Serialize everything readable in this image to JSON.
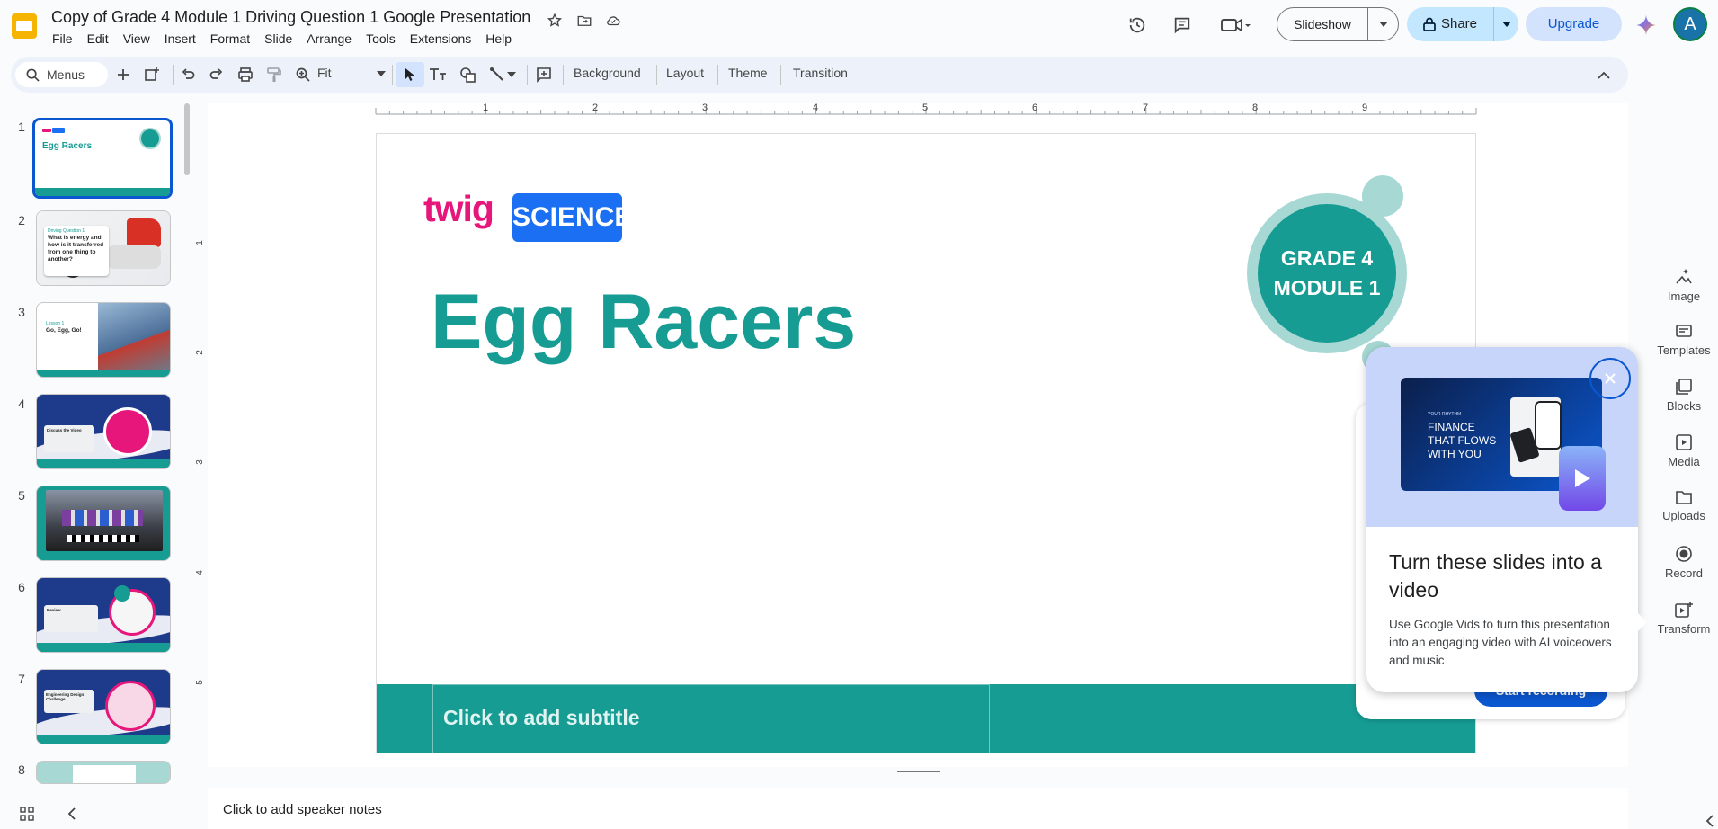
{
  "header": {
    "title": "Copy of Grade 4 Module 1 Driving Question 1 Google Presentation",
    "menu": [
      "File",
      "Edit",
      "View",
      "Insert",
      "Format",
      "Slide",
      "Arrange",
      "Tools",
      "Extensions",
      "Help"
    ],
    "slideshow_label": "Slideshow",
    "share_label": "Share",
    "upgrade_label": "Upgrade",
    "avatar_letter": "A"
  },
  "toolbar": {
    "search_label": "Menus",
    "zoom": "Fit",
    "background_label": "Background",
    "layout_label": "Layout",
    "theme_label": "Theme",
    "transition_label": "Transition"
  },
  "ruler": {
    "h": [
      "1",
      "2",
      "3",
      "4",
      "5",
      "6",
      "7",
      "8",
      "9"
    ],
    "v": [
      "1",
      "2",
      "3",
      "4",
      "5"
    ]
  },
  "filmstrip": {
    "numbers": [
      "1",
      "2",
      "3",
      "4",
      "5",
      "6",
      "7",
      "8"
    ],
    "thumbs": [
      {
        "title": "Egg Racers"
      },
      {
        "heading": "Driving Question 1",
        "body": "What is energy and how is it transferred from one thing to another?"
      },
      {
        "heading": "Lesson 1",
        "body": "Go, Egg, Go!"
      },
      {
        "body": "Discuss the Video"
      },
      {
        "body": ""
      },
      {
        "body": "Review"
      },
      {
        "body": "Engineering Design Challenge"
      },
      {
        "body": ""
      }
    ]
  },
  "slide": {
    "brand_twig": "twig",
    "brand_science": "SCIENCE",
    "badge_line1": "GRADE 4",
    "badge_line2": "MODULE 1",
    "title": "Egg Racers",
    "subtitle_placeholder": "Click to add subtitle"
  },
  "notes_placeholder": "Click to add speaker notes",
  "right_panel": [
    {
      "label": "Image",
      "icon": "image-icon"
    },
    {
      "label": "Templates",
      "icon": "templates-icon"
    },
    {
      "label": "Blocks",
      "icon": "blocks-icon"
    },
    {
      "label": "Media",
      "icon": "media-icon"
    },
    {
      "label": "Uploads",
      "icon": "uploads-icon"
    },
    {
      "label": "Record",
      "icon": "record-icon"
    },
    {
      "label": "Transform",
      "icon": "transform-icon"
    }
  ],
  "popup": {
    "promo_line1": "FINANCE",
    "promo_line2": "THAT FLOWS",
    "promo_line3": "WITH YOU",
    "promo_tag": "YOUR RHYTHM",
    "title": "Turn these slides into a video",
    "body": "Use Google Vids to turn this presentation into an engaging video with AI voiceovers and music",
    "hidden_button": "Start recording"
  },
  "colors": {
    "teal": "#169c93",
    "teal_light": "#a7d8d4",
    "twig_pink": "#e6167a",
    "science_blue": "#1a6ff2",
    "share_bg": "#c2e7ff",
    "accent_blue": "#0b57d0"
  }
}
